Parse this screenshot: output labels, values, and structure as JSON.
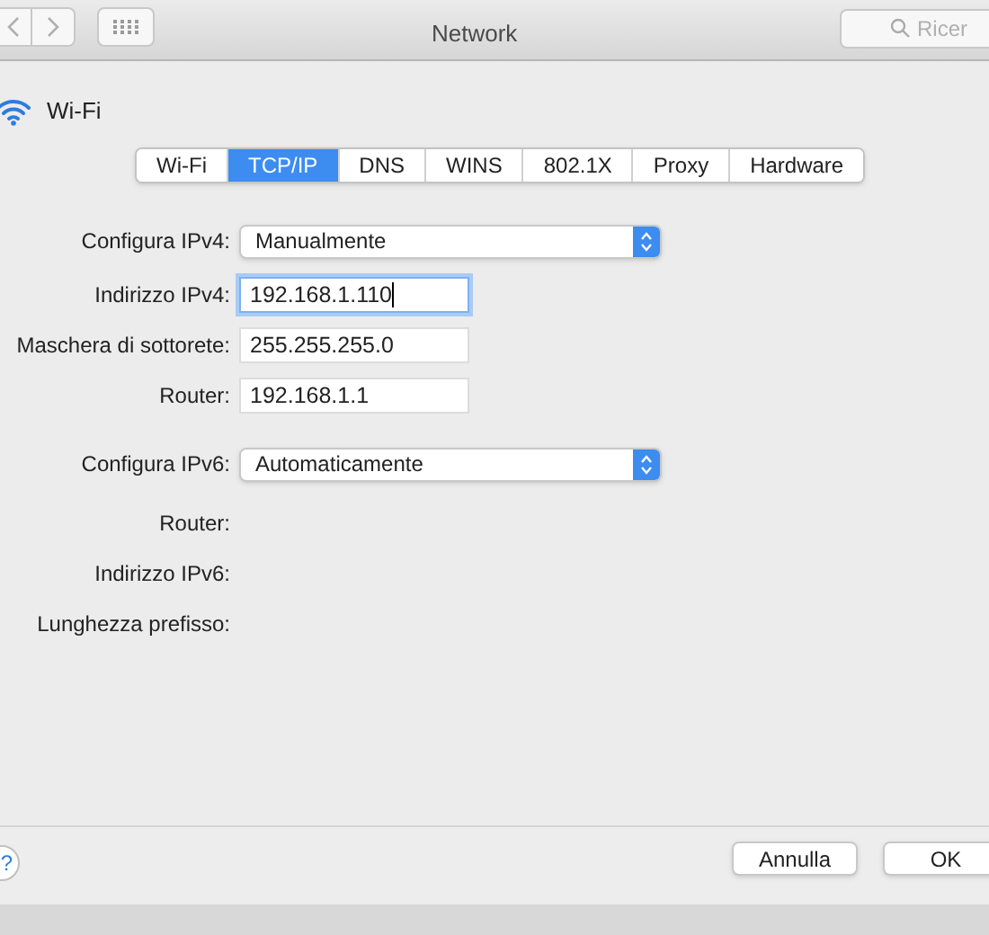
{
  "window": {
    "title": "Network",
    "search": {
      "placeholder": "Ricer"
    }
  },
  "interface": {
    "name": "Wi-Fi"
  },
  "tabs": [
    {
      "label": "Wi-Fi",
      "selected": false
    },
    {
      "label": "TCP/IP",
      "selected": true
    },
    {
      "label": "DNS",
      "selected": false
    },
    {
      "label": "WINS",
      "selected": false
    },
    {
      "label": "802.1X",
      "selected": false
    },
    {
      "label": "Proxy",
      "selected": false
    },
    {
      "label": "Hardware",
      "selected": false
    }
  ],
  "form": [
    {
      "kind": "popup",
      "label": "Configura IPv4:",
      "value": "Manualmente"
    },
    {
      "kind": "field",
      "label": "Indirizzo IPv4:",
      "value": "192.168.1.110",
      "focused": true
    },
    {
      "kind": "field",
      "label": "Maschera di sottorete:",
      "value": "255.255.255.0",
      "focused": false
    },
    {
      "kind": "field",
      "label": "Router:",
      "value": "192.168.1.1",
      "focused": false
    },
    {
      "kind": "popup",
      "label": "Configura IPv6:",
      "value": "Automaticamente"
    },
    {
      "kind": "info",
      "label": "Router:"
    },
    {
      "kind": "info",
      "label": "Indirizzo IPv6:"
    },
    {
      "kind": "info",
      "label": "Lunghezza prefisso:"
    }
  ],
  "help": "?",
  "buttons": [
    "Annulla",
    "OK"
  ]
}
